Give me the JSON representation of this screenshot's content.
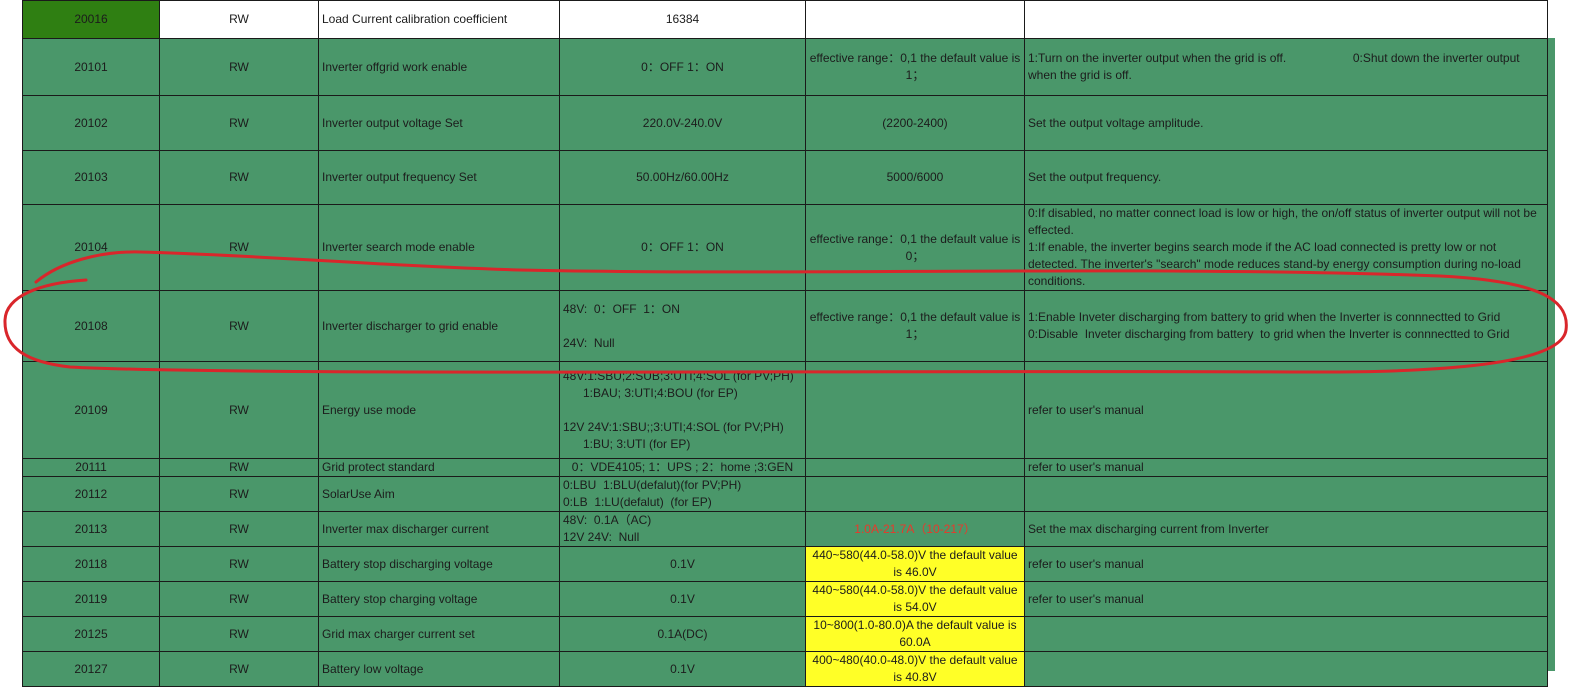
{
  "rows": [
    {
      "addr": "20016",
      "rw": "RW",
      "name": "Load Current calibration coefficient",
      "unit": "16384",
      "range": "",
      "desc": ""
    },
    {
      "addr": "20101",
      "rw": "RW",
      "name": "Inverter offgrid work enable",
      "unit": "0：OFF 1：ON",
      "range": "effective range：0,1 the default value is 1；",
      "desc": "1:Turn on the inverter output when the grid is off.                    0:Shut down the inverter output when the grid is off."
    },
    {
      "addr": "20102",
      "rw": "RW",
      "name": "Inverter output voltage Set",
      "unit": "220.0V-240.0V",
      "range": "(2200-2400)",
      "desc": "Set the output voltage amplitude."
    },
    {
      "addr": "20103",
      "rw": "RW",
      "name": "Inverter output frequency Set",
      "unit": "50.00Hz/60.00Hz",
      "range": "5000/6000",
      "desc": "Set the output frequency."
    },
    {
      "addr": "20104",
      "rw": "RW",
      "name": "Inverter search mode enable",
      "unit": "0：OFF 1：ON",
      "range": "effective range：0,1 the default value is 0；",
      "desc": "0:If disabled, no matter connect load is low or high, the on/off status of inverter output will not be effected.\n1:If enable, the inverter begins search mode if the AC load connected is pretty low or not detected. The inverter's \"search\" mode reduces stand-by energy consumption during no-load conditions."
    },
    {
      "addr": "20108",
      "rw": "RW",
      "name": "Inverter discharger to grid enable",
      "unit": "48V:  0：OFF  1：ON\n\n24V:  Null",
      "range": "effective range：0,1 the default value is 1；",
      "desc": "1:Enable Inveter discharging from battery to grid when the Inverter is connnectted to Grid\n0:Disable  Inveter discharging from battery  to grid when the Inverter is connnectted to Grid"
    },
    {
      "addr": "20109",
      "rw": "RW",
      "name": "Energy use mode",
      "unit": "48V:1:SBU;2:SUB;3:UTI;4:SOL (for PV;PH)\n      1:BAU; 3:UTI;4:BOU (for EP)\n\n12V 24V:1:SBU;;3:UTI;4:SOL (for PV;PH)\n      1:BU; 3:UTI (for EP)",
      "range": "",
      "desc": "refer to user's manual"
    },
    {
      "addr": "20111",
      "rw": "RW",
      "name": "Grid protect standard",
      "unit": "0：VDE4105; 1：UPS ; 2：home ;3:GEN",
      "range": "",
      "desc": "refer to user's manual"
    },
    {
      "addr": "20112",
      "rw": "RW",
      "name": "SolarUse Aim",
      "unit": "0:LBU  1:BLU(defalut)(for PV;PH)\n0:LB  1:LU(defalut)  (for EP)",
      "range": "",
      "desc": ""
    },
    {
      "addr": "20113",
      "rw": "RW",
      "name": "Inverter max discharger current",
      "unit": "48V:  0.1A（AC)\n12V 24V:  Null",
      "range": "1.0A-21.7A（10-217）",
      "desc": "Set the max discharging current from Inverter"
    },
    {
      "addr": "20118",
      "rw": "RW",
      "name": "Battery stop discharging voltage",
      "unit": "0.1V",
      "range": "440~580(44.0-58.0)V the default value is 46.0V",
      "desc": "refer to user's manual"
    },
    {
      "addr": "20119",
      "rw": "RW",
      "name": "Battery stop charging voltage",
      "unit": "0.1V",
      "range": "440~580(44.0-58.0)V the default value is 54.0V",
      "desc": "refer to user's manual"
    },
    {
      "addr": "20125",
      "rw": "RW",
      "name": "Grid max charger current set",
      "unit": "0.1A(DC)",
      "range": "10~800(1.0-80.0)A the default value is 60.0A",
      "desc": ""
    },
    {
      "addr": "20127",
      "rw": "RW",
      "name": "Battery low voltage",
      "unit": "0.1V",
      "range": "400~480(40.0-48.0)V the default value is 40.8V",
      "desc": ""
    }
  ],
  "colors": {
    "cell_green": "#4a976a",
    "header_addr_green": "#2f7f12",
    "highlight_yellow": "#ffff27",
    "red_text": "#e8392b",
    "annotation_red": "#d9262b"
  }
}
